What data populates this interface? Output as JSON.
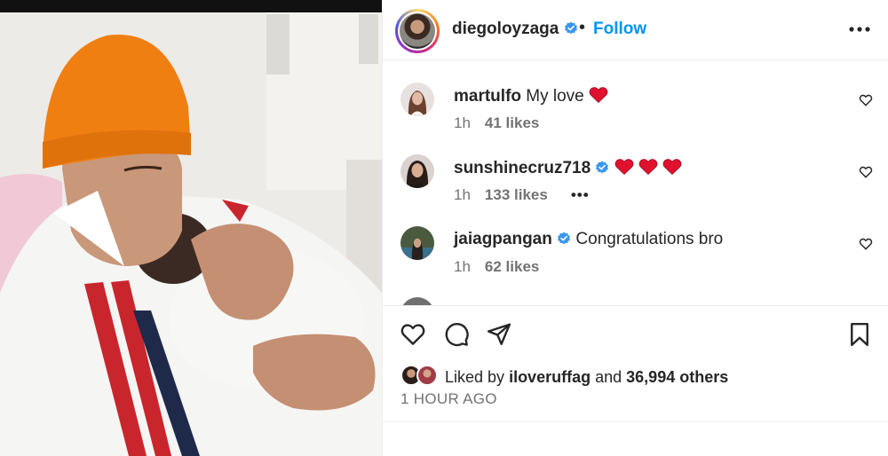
{
  "post": {
    "owner_username": "diegoloyzaga",
    "separator": "•",
    "follow_label": "Follow",
    "more_label": "•••"
  },
  "comments": [
    {
      "username": "martulfo",
      "text": "My love",
      "hearts": 1,
      "verified": false,
      "time": "1h",
      "likes": "41 likes"
    },
    {
      "username": "sunshinecruz718",
      "text": "",
      "hearts": 3,
      "verified": true,
      "time": "1h",
      "likes": "133 likes",
      "more": "•••"
    },
    {
      "username": "jaiagpangan",
      "text": "Congratulations bro",
      "hearts": 0,
      "verified": true,
      "time": "1h",
      "likes": "62 likes"
    }
  ],
  "footer": {
    "liked_by_prefix": "Liked by",
    "liked_by_user": "iloveruffag",
    "liked_by_and": "and",
    "liked_by_others": "36,994 others",
    "timestamp": "1 HOUR AGO"
  },
  "icons": {
    "verified": "verified-badge-icon",
    "like": "heart-outline-icon",
    "comment": "speech-bubble-icon",
    "share": "paper-plane-icon",
    "save": "bookmark-icon",
    "more": "ellipsis-icon"
  },
  "colors": {
    "accent": "#0095f6",
    "verified": "#3897f0",
    "heart": "#e0102f",
    "secondary_text": "#737373"
  }
}
